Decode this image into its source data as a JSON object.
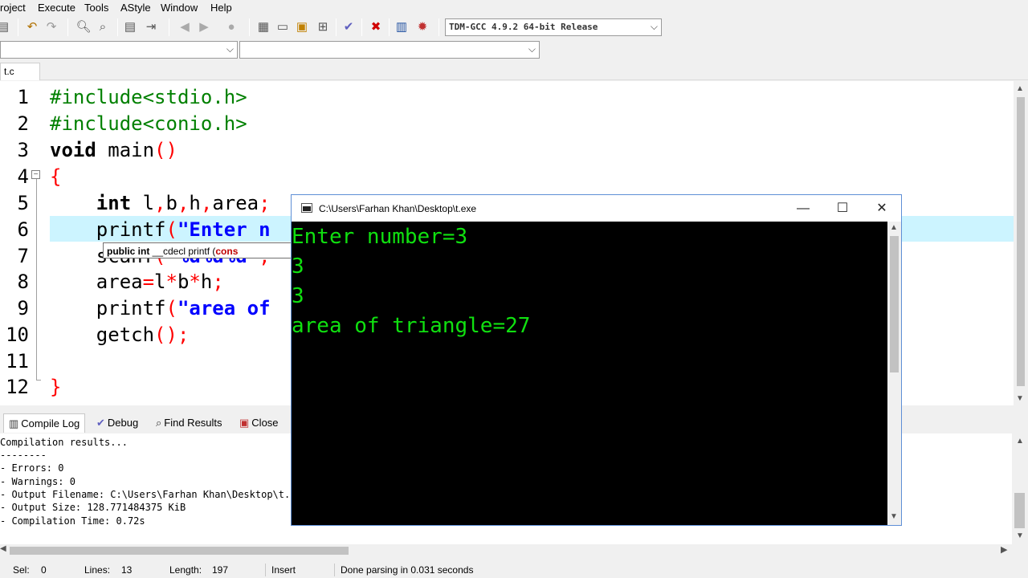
{
  "menu": {
    "items": [
      "roject",
      "Execute",
      "Tools",
      "AStyle",
      "Window",
      "Help"
    ]
  },
  "toolbar": {
    "compiler_select": "TDM-GCC 4.9.2 64-bit Release",
    "icons": [
      "save-all-icon",
      "undo-icon",
      "redo-icon",
      "find-icon",
      "replace-icon",
      "goto-icon",
      "indent-icon",
      "bookmark-prev-icon",
      "bookmark-next-icon",
      "stop-icon",
      "new-project-icon",
      "window-icon",
      "class-icon",
      "grid-icon",
      "check-icon",
      "close-icon",
      "chart-icon",
      "profile-icon"
    ]
  },
  "editor": {
    "tab_label": "t.c",
    "line_numbers": [
      "1",
      "2",
      "3",
      "4",
      "5",
      "6",
      "7",
      "8",
      "9",
      "10",
      "11",
      "12"
    ],
    "lines": [
      [
        {
          "t": "#include<stdio.h>",
          "c": "pp"
        }
      ],
      [
        {
          "t": "#include<conio.h>",
          "c": "pp"
        }
      ],
      [
        {
          "t": "void",
          "c": "kw"
        },
        {
          "t": " main",
          "c": ""
        },
        {
          "t": "()",
          "c": "sym"
        }
      ],
      [
        {
          "t": "{",
          "c": "sym"
        }
      ],
      [
        {
          "t": "    ",
          "c": ""
        },
        {
          "t": "int",
          "c": "kw"
        },
        {
          "t": " l",
          "c": ""
        },
        {
          "t": ",",
          "c": "sym"
        },
        {
          "t": "b",
          "c": ""
        },
        {
          "t": ",",
          "c": "sym"
        },
        {
          "t": "h",
          "c": ""
        },
        {
          "t": ",",
          "c": "sym"
        },
        {
          "t": "area",
          "c": ""
        },
        {
          "t": ";",
          "c": "sym"
        }
      ],
      [
        {
          "t": "    printf",
          "c": ""
        },
        {
          "t": "(",
          "c": "sym"
        },
        {
          "t": "\"Enter n",
          "c": "str"
        }
      ],
      [
        {
          "t": "    scanf",
          "c": ""
        },
        {
          "t": "(",
          "c": "sym"
        },
        {
          "t": "\"%d%d%d\"",
          "c": "str"
        },
        {
          "t": ",",
          "c": "sym"
        }
      ],
      [
        {
          "t": "    area",
          "c": ""
        },
        {
          "t": "=",
          "c": "sym"
        },
        {
          "t": "l",
          "c": ""
        },
        {
          "t": "*",
          "c": "sym"
        },
        {
          "t": "b",
          "c": ""
        },
        {
          "t": "*",
          "c": "sym"
        },
        {
          "t": "h",
          "c": ""
        },
        {
          "t": ";",
          "c": "sym"
        }
      ],
      [
        {
          "t": "    printf",
          "c": ""
        },
        {
          "t": "(",
          "c": "sym"
        },
        {
          "t": "\"area of",
          "c": "str"
        }
      ],
      [
        {
          "t": "    getch",
          "c": ""
        },
        {
          "t": "();",
          "c": "sym"
        }
      ],
      [
        {
          "t": "",
          "c": ""
        }
      ],
      [
        {
          "t": "}",
          "c": "sym"
        }
      ]
    ],
    "tooltip": {
      "p1": "public int",
      "p2": " __cdecl printf (",
      "p3": "cons"
    }
  },
  "bottom_panel": {
    "tabs": [
      {
        "label": "Compile Log",
        "icon": "chart-icon"
      },
      {
        "label": "Debug",
        "icon": "check-icon"
      },
      {
        "label": "Find Results",
        "icon": "find-icon"
      },
      {
        "label": "Close",
        "icon": "close-icon"
      }
    ],
    "log_lines": [
      "Compilation results...",
      "--------",
      "- Errors: 0",
      "- Warnings: 0",
      "- Output Filename: C:\\Users\\Farhan Khan\\Desktop\\t.exe",
      "- Output Size: 128.771484375 KiB",
      "- Compilation Time: 0.72s"
    ]
  },
  "status": {
    "sel_label": "Sel:",
    "sel_value": "0",
    "lines_label": "Lines:",
    "lines_value": "13",
    "length_label": "Length:",
    "length_value": "197",
    "mode": "Insert",
    "message": "Done parsing in 0.031 seconds"
  },
  "console": {
    "title": "C:\\Users\\Farhan Khan\\Desktop\\t.exe",
    "output": [
      "Enter number=3",
      "3",
      "3",
      "area of triangle=27"
    ]
  },
  "colors": {
    "console_text": "#10e010",
    "line_highlight": "#ccf4ff",
    "keyword_symbol": "#ff0000",
    "string": "#0000ff",
    "preprocessor": "#008000"
  }
}
